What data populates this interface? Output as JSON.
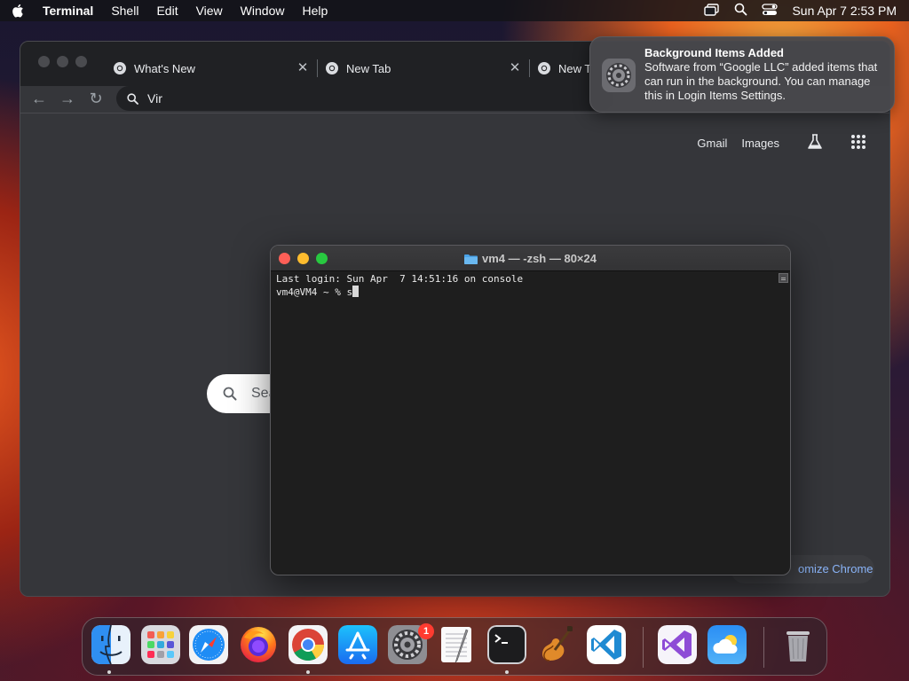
{
  "menubar": {
    "app": "Terminal",
    "items": [
      "Shell",
      "Edit",
      "View",
      "Window",
      "Help"
    ],
    "clock": "Sun Apr 7  2:53 PM"
  },
  "chrome": {
    "tabs": [
      {
        "label": "What's New"
      },
      {
        "label": "New Tab"
      },
      {
        "label": "New T"
      }
    ],
    "omnibox_value": "Vir",
    "links": {
      "gmail": "Gmail",
      "images": "Images"
    },
    "search_placeholder": "Sea",
    "customize_label": "omize Chrome"
  },
  "notification": {
    "title": "Background Items Added",
    "body": "Software from “Google LLC” added items that can run in the background. You can manage this in Login Items Settings."
  },
  "terminal": {
    "title": "vm4 — -zsh — 80×24",
    "line1": "Last login: Sun Apr  7 14:51:16 on console",
    "prompt": "vm4@VM4 ~ % s"
  },
  "dock": {
    "settings_badge": "1",
    "apps": [
      "finder",
      "launchpad",
      "safari",
      "firefox",
      "chrome",
      "app-store",
      "system-settings",
      "textedit",
      "terminal",
      "garageband",
      "vscode",
      "visual-studio",
      "weather",
      "trash"
    ]
  }
}
